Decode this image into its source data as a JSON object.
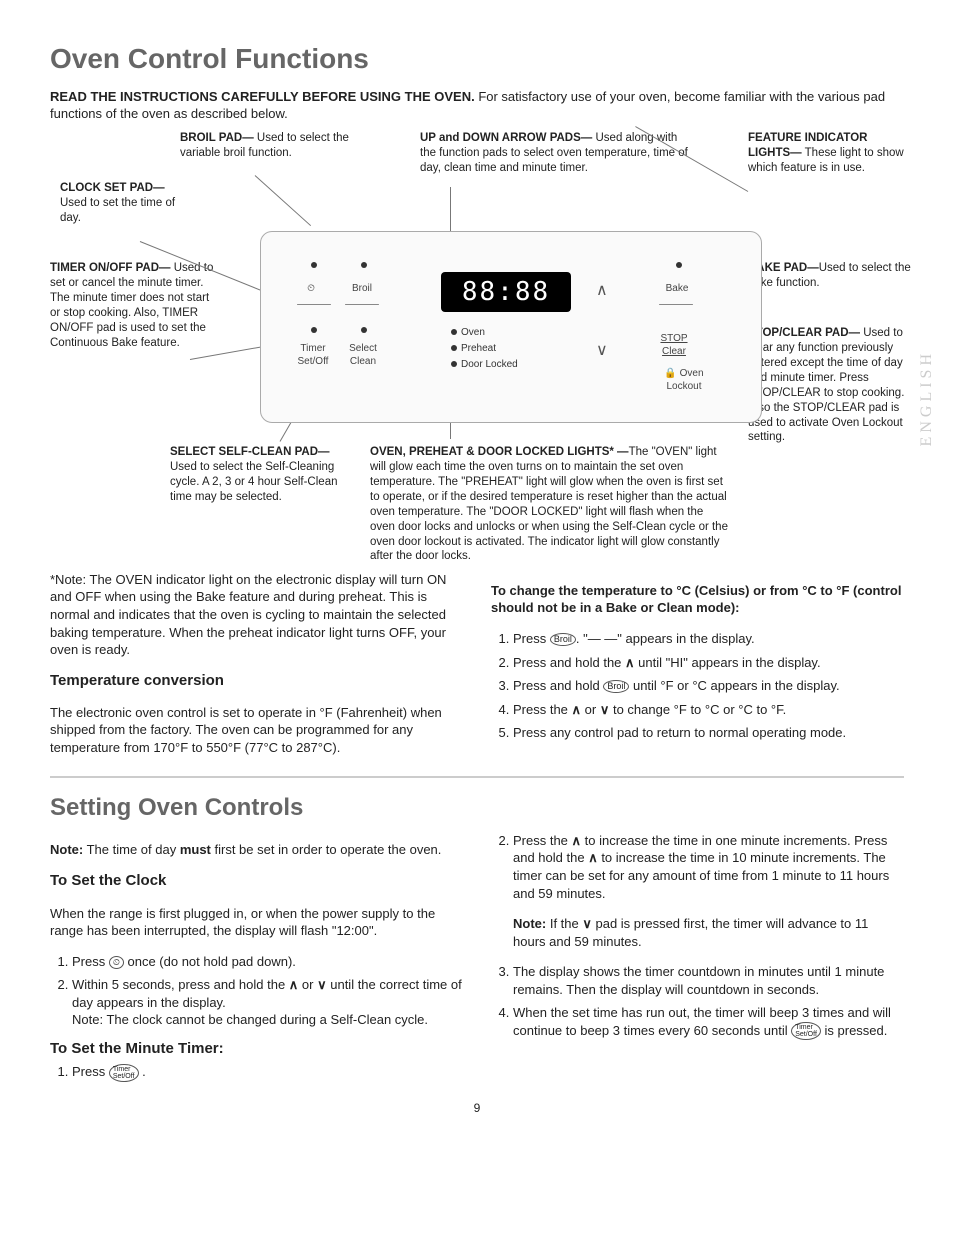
{
  "page_number": "9",
  "side_tab": "ENGLISH",
  "h1": "Oven Control Functions",
  "intro_bold": "READ THE INSTRUCTIONS CAREFULLY BEFORE USING THE OVEN.",
  "intro_rest": " For satisfactory use of your oven, become familiar with the various pad functions of the oven as described below.",
  "callouts": {
    "broil": {
      "title": "BROIL PAD—",
      "text": " Used to select the variable broil function."
    },
    "arrows": {
      "title": "UP and DOWN ARROW PADS—",
      "text": " Used along with the function pads to select oven temperature, time of day, clean time and minute timer."
    },
    "feature": {
      "title": "FEATURE INDICATOR LIGHTS—",
      "text": " These light to show which feature is in use."
    },
    "clock": {
      "title": "CLOCK SET PAD—",
      "text": " Used to set the time of day."
    },
    "timer": {
      "title": "TIMER ON/OFF PAD—",
      "text": " Used to set or cancel the minute timer. The minute timer does not start or stop cooking. Also, TIMER ON/OFF pad is used to set the Continuous Bake feature."
    },
    "bake": {
      "title": "BAKE PAD—",
      "text": "Used to select the bake function."
    },
    "stop": {
      "title": "STOP/CLEAR PAD—",
      "text": " Used to clear any function previously entered except the time of day and minute timer. Press STOP/CLEAR to stop cooking. Also the STOP/CLEAR pad is used to activate Oven Lockout setting."
    },
    "selfclean": {
      "title": "SELECT SELF-CLEAN PAD—",
      "text": " Used to select the Self-Cleaning cycle. A 2, 3 or 4 hour Self-Clean time may be selected."
    },
    "lights": {
      "title": "OVEN, PREHEAT & DOOR LOCKED LIGHTS* —",
      "text": "The \"OVEN\" light will glow each time the oven turns on to maintain the set oven temperature. The \"PREHEAT\" light will glow when the oven is first set to operate, or if the desired temperature is reset higher than the actual oven temperature. The \"DOOR LOCKED\" light will flash when the oven door locks and unlocks or when using the Self-Clean cycle or the oven door lockout is activated. The indicator light will glow constantly after the door locks."
    }
  },
  "panel": {
    "display": "88:88",
    "pads": {
      "clock": "⏲",
      "broil": "Broil",
      "timer": "Timer\nSet/Off",
      "select": "Select\nClean",
      "bake": "Bake",
      "stop": "STOP\nClear",
      "lockout": "Oven\nLockout"
    },
    "lamps": {
      "oven": "Oven",
      "preheat": "Preheat",
      "doorlocked": "Door Locked"
    }
  },
  "note_oven": "*Note: The OVEN indicator light on the electronic display will turn ON and OFF when using the Bake feature and during preheat. This is normal and indicates that the oven is cycling to maintain the selected baking temperature. When the preheat indicator light turns OFF, your oven is ready.",
  "temp_h": "Temperature conversion",
  "temp_p": "The electronic oven control is set to operate in °F (Fahrenheit) when shipped from the factory. The oven can be programmed for any temperature from 170°F to 550°F (77°C to 287°C).",
  "conv_h": "To change the temperature to °C (Celsius) or from °C to °F (control should not be in a Bake or Clean mode):",
  "conv": {
    "s1a": "Press ",
    "s1b": ". \"— —\" appears in the display.",
    "s2a": "Press and hold the ",
    "s2b": " until \"HI\" appears in the display.",
    "s3a": "Press and hold ",
    "s3b": " until °F or °C appears in the display.",
    "s4a": "Press the ",
    "s4b": " or ",
    "s4c": " to change °F to °C or °C to °F.",
    "s5": "Press any control pad to return to normal operating mode."
  },
  "h2": "Setting Oven Controls",
  "note2a": "Note:",
  "note2b": " The time of day ",
  "note2c": "must",
  "note2d": " first be set in order to operate the oven.",
  "clock_h": "To Set the Clock",
  "clock_p": "When the range is first plugged in, or when the power supply to the range has been interrupted, the display will flash \"12:00\".",
  "clock_s1a": "Press ",
  "clock_s1b": " once (do not hold pad down).",
  "clock_s2a": "Within 5 seconds, press and hold the ",
  "clock_s2b": " or ",
  "clock_s2c": " until the correct time of day appears in the display.",
  "clock_note": "Note: The clock cannot be changed during a Self-Clean cycle.",
  "min_h": "To Set the Minute Timer:",
  "min_s1a": "Press ",
  "min_s1b": " .",
  "right_s2a": "Press the ",
  "right_s2b": " to increase the time in one minute increments. Press and hold the ",
  "right_s2c": " to increase the time in 10 minute increments. The timer can be set for any amount of time from 1 minute to 11 hours and 59 minutes.",
  "right_note_a": "Note:",
  "right_note_b": " If the ",
  "right_note_c": " pad is pressed first, the timer will advance to 11 hours and 59 minutes.",
  "right_s3": "The display shows the timer countdown in minutes until 1 minute remains. Then the display will countdown in seconds.",
  "right_s4a": "When the set time has run out, the timer will beep 3 times and will continue to beep 3 times every 60 seconds until ",
  "right_s4b": " is pressed.",
  "icons": {
    "broil_small": "Broil",
    "clock_small": "⏲",
    "timer_small": "Timer\nSet/Off"
  }
}
